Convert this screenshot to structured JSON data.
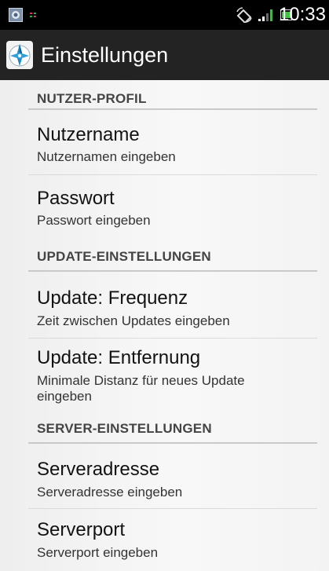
{
  "status_bar": {
    "time": "10:33",
    "icons": [
      "app-notification-icon",
      "dots-icon",
      "rotation-icon",
      "signal-icon",
      "battery-icon"
    ]
  },
  "action_bar": {
    "title": "Einstellungen",
    "icon": "compass-app-icon"
  },
  "sections": [
    {
      "header": "NUTZER-PROFIL",
      "items": [
        {
          "title": "Nutzername",
          "summary": "Nutzernamen eingeben"
        },
        {
          "title": "Passwort",
          "summary": "Passwort eingeben"
        }
      ]
    },
    {
      "header": "UPDATE-EINSTELLUNGEN",
      "items": [
        {
          "title": "Update: Frequenz",
          "summary": "Zeit zwischen Updates eingeben"
        },
        {
          "title": "Update: Entfernung",
          "summary": "Minimale Distanz für neues Update eingeben"
        }
      ]
    },
    {
      "header": "SERVER-EINSTELLUNGEN",
      "items": [
        {
          "title": "Serveradresse",
          "summary": "Serveradresse eingeben"
        },
        {
          "title": "Serverport",
          "summary": "Serverport eingeben"
        }
      ]
    }
  ],
  "colors": {
    "status_bar_bg": "#000000",
    "action_bar_bg": "#232323",
    "content_bg": "#f4f4f4",
    "accent_blue": "#1e88c8"
  }
}
